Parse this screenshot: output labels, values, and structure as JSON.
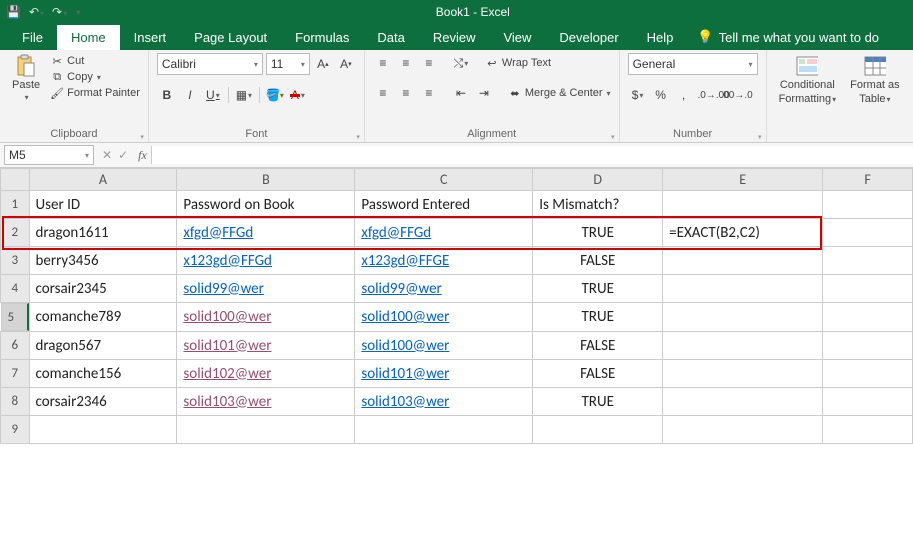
{
  "window": {
    "title": "Book1 - Excel"
  },
  "qat": {
    "save": "💾",
    "undo": "↶",
    "redo": "↷"
  },
  "tabs": [
    "File",
    "Home",
    "Insert",
    "Page Layout",
    "Formulas",
    "Data",
    "Review",
    "View",
    "Developer",
    "Help"
  ],
  "active_tab": "Home",
  "tellme": {
    "icon": "💡",
    "text": "Tell me what you want to do"
  },
  "ribbon": {
    "clipboard": {
      "paste": "Paste",
      "cut": "Cut",
      "copy": "Copy",
      "format_painter": "Format Painter",
      "label": "Clipboard"
    },
    "font": {
      "name": "Calibri",
      "size": "11",
      "bold": "B",
      "italic": "I",
      "underline": "U",
      "label": "Font"
    },
    "alignment": {
      "wrap": "Wrap Text",
      "merge": "Merge & Center",
      "label": "Alignment"
    },
    "number": {
      "format": "General",
      "label": "Number"
    },
    "styles": {
      "cond": "Conditional Formatting",
      "table": "Format as Table",
      "cond1": "Conditional",
      "cond2": "Formatting",
      "tab1": "Format as",
      "tab2": "Table"
    }
  },
  "namebox": "M5",
  "formula_bar": "",
  "columns": [
    "A",
    "B",
    "C",
    "D",
    "E",
    "F"
  ],
  "rows": [
    {
      "n": "1",
      "A": "User ID",
      "B": "Password on Book",
      "C": "Password Entered",
      "D": "Is Mismatch?",
      "E": "",
      "F": ""
    },
    {
      "n": "2",
      "A": "dragon1611",
      "B": "xfgd@FFGd",
      "C": "xfgd@FFGd",
      "D": "TRUE",
      "E": "=EXACT(B2,C2)",
      "F": ""
    },
    {
      "n": "3",
      "A": "berry3456",
      "B": "x123gd@FFGd",
      "C": "x123gd@FFGE",
      "D": "FALSE",
      "E": "",
      "F": ""
    },
    {
      "n": "4",
      "A": "corsair2345",
      "B": "solid99@wer",
      "C": "solid99@wer",
      "D": "TRUE",
      "E": "",
      "F": ""
    },
    {
      "n": "5",
      "A": "comanche789",
      "B": "solid100@wer",
      "C": "solid100@wer",
      "D": "TRUE",
      "E": "",
      "F": ""
    },
    {
      "n": "6",
      "A": "dragon567",
      "B": "solid101@wer",
      "C": "solid100@wer",
      "D": "FALSE",
      "E": "",
      "F": ""
    },
    {
      "n": "7",
      "A": "comanche156",
      "B": "solid102@wer",
      "C": "solid101@wer",
      "D": "FALSE",
      "E": "",
      "F": ""
    },
    {
      "n": "8",
      "A": "corsair2346",
      "B": "solid103@wer",
      "C": "solid103@wer",
      "D": "TRUE",
      "E": "",
      "F": ""
    },
    {
      "n": "9",
      "A": "",
      "B": "",
      "C": "",
      "D": "",
      "E": "",
      "F": ""
    }
  ],
  "link_style": {
    "blue_rows_B": [
      2,
      3,
      4
    ],
    "purple_rows_B": [
      5,
      6,
      7,
      8
    ],
    "blue_rows_C": [
      2,
      3,
      4,
      5,
      6,
      7,
      8
    ]
  },
  "selected_row_header": 5
}
